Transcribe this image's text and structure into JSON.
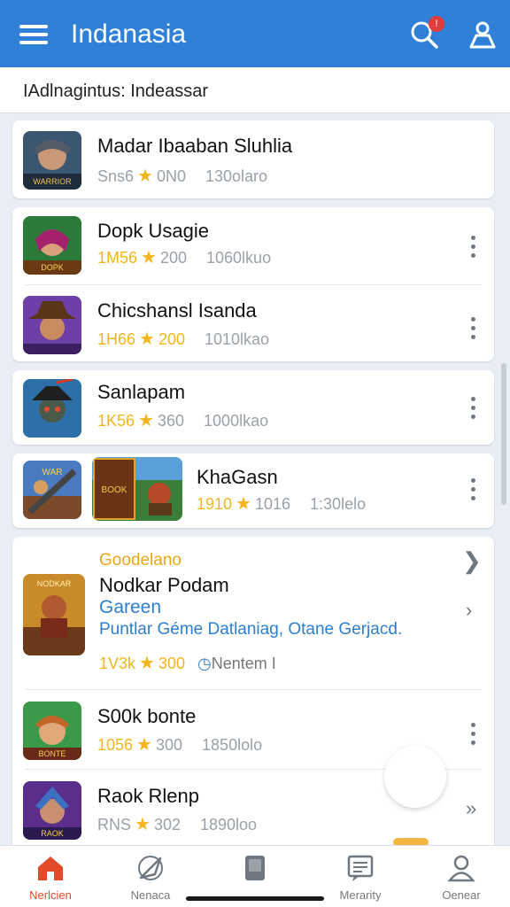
{
  "header": {
    "title": "Indanasia",
    "notification_count": "!",
    "colors": {
      "bar": "#2f80d6",
      "accent": "#f2b51d"
    }
  },
  "search": {
    "label": "IAdlnagintus: Indeassar"
  },
  "games": [
    {
      "name": "Madar Ibaaban Sluhlia",
      "size": "Sns6",
      "rating": "0N0",
      "downloads": "130olaro",
      "icon": "warrior-portrait-icon"
    },
    {
      "name": "Dopk Usagie",
      "size": "1M56",
      "rating": "200",
      "downloads": "1060lkuo",
      "icon": "heroine-portrait-icon"
    },
    {
      "name": "Chicshansl Isanda",
      "size": "1H66",
      "rating": "200",
      "downloads": "1010lkao",
      "icon": "cowboy-portrait-icon"
    },
    {
      "name": "Sanlapam",
      "size": "1K56",
      "rating": "360",
      "downloads": "1000lkao",
      "icon": "ninja-portrait-icon"
    },
    {
      "name": "KhaGasn",
      "size": "1910",
      "rating": "1016",
      "downloads": "1:30lelo",
      "icon": "battle-scene-icon"
    }
  ],
  "featured": {
    "tag": "Goodelano",
    "name": "Nodkar Podam",
    "subtitle": "Gareen",
    "description": "Puntlar Géme Datlaniag, Otane Gerjacd.",
    "size": "1V3k",
    "rating": "300",
    "duration": "Nentem I",
    "icon": "barbarian-poster-icon",
    "banner_icon": "game-poster-icon"
  },
  "more_games": [
    {
      "name": "S00k bonte",
      "size": "1056",
      "rating": "300",
      "downloads": "1850lolo",
      "icon": "elf-portrait-icon"
    },
    {
      "name": "Raok Rlenp",
      "size": "RNS",
      "rating": "302",
      "downloads": "1890loo",
      "icon": "knight-portrait-icon"
    }
  ],
  "bottom_nav": [
    {
      "label": "Nerlcien",
      "icon": "home-icon"
    },
    {
      "label": "Nenaca",
      "icon": "compass-icon"
    },
    {
      "label": "",
      "icon": "library-icon"
    },
    {
      "label": "Merarity",
      "icon": "news-icon"
    },
    {
      "label": "Oenear",
      "icon": "profile-icon"
    }
  ]
}
